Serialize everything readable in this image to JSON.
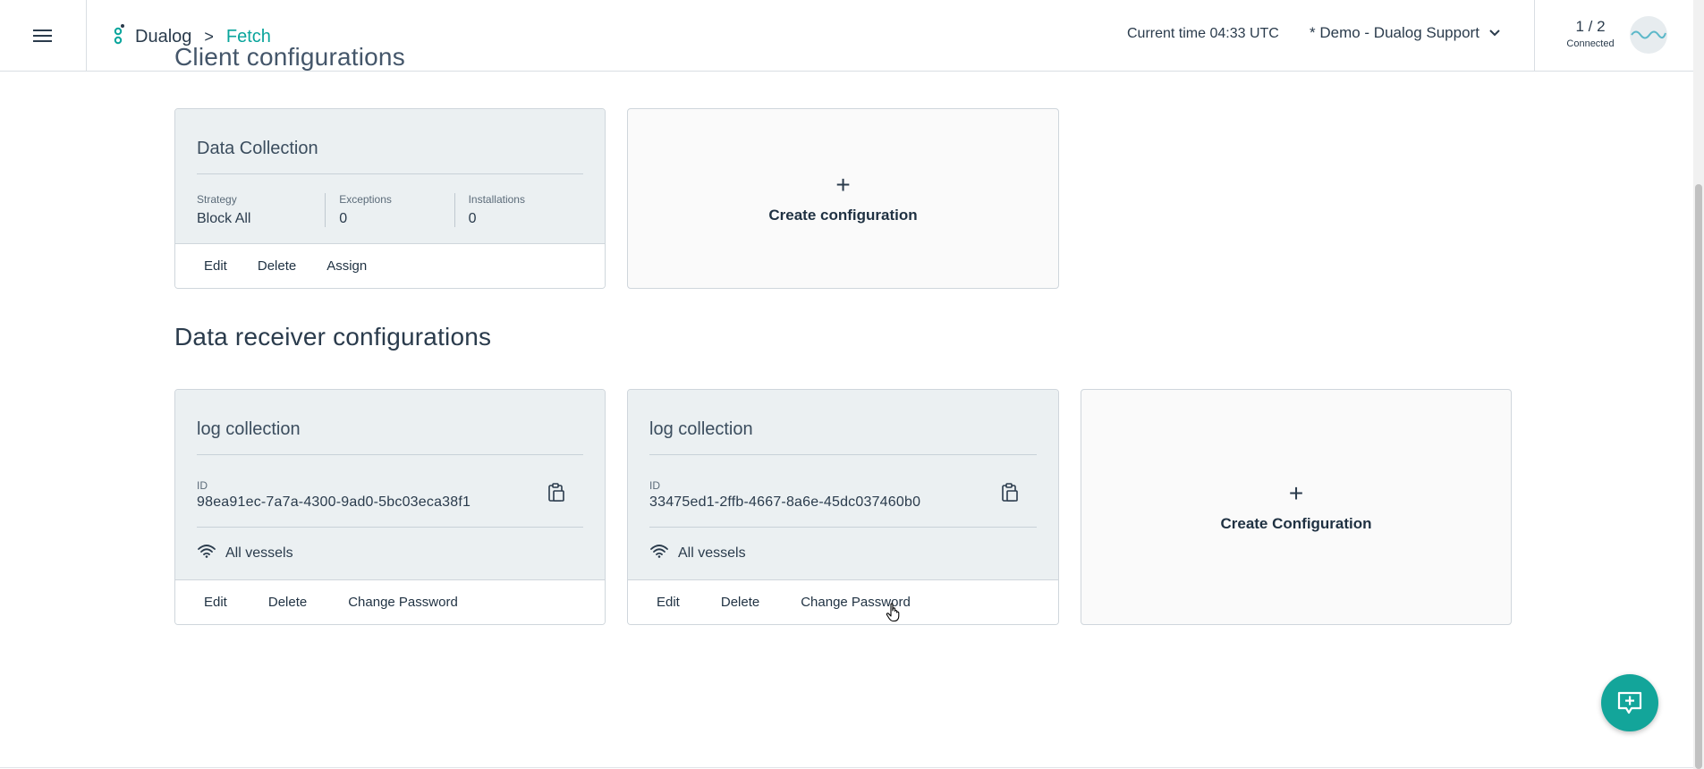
{
  "header": {
    "menu_icon": "hamburger-menu-icon",
    "logo_icon": "dualog-logo-icon",
    "breadcrumb": {
      "root": "Dualog",
      "separator": ">",
      "current": "Fetch"
    },
    "current_time": "Current time 04:33 UTC",
    "organization": "* Demo - Dualog Support",
    "connection": {
      "count": "1 / 2",
      "label": "Connected"
    }
  },
  "client_section": {
    "title": "Client configurations",
    "cards": [
      {
        "name": "Data Collection",
        "stats": [
          {
            "label": "Strategy",
            "value": "Block All"
          },
          {
            "label": "Exceptions",
            "value": "0"
          },
          {
            "label": "Installations",
            "value": "0"
          }
        ],
        "actions": [
          "Edit",
          "Delete",
          "Assign"
        ]
      }
    ],
    "create_label": "Create configuration"
  },
  "receiver_section": {
    "title": "Data receiver configurations",
    "cards": [
      {
        "name": "log collection",
        "id_label": "ID",
        "id_value": "98ea91ec-7a7a-4300-9ad0-5bc03eca38f1",
        "vessels": "All vessels",
        "actions": [
          "Edit",
          "Delete",
          "Change Password"
        ]
      },
      {
        "name": "log collection",
        "id_label": "ID",
        "id_value": "33475ed1-2ffb-4667-8a6e-45dc037460b0",
        "vessels": "All vessels",
        "actions": [
          "Edit",
          "Delete",
          "Change Password"
        ]
      }
    ],
    "create_label": "Create Configuration"
  },
  "colors": {
    "accent": "#13a59a",
    "breadcrumb_current": "#0aa59c",
    "card_bg": "#ebf0f2"
  }
}
